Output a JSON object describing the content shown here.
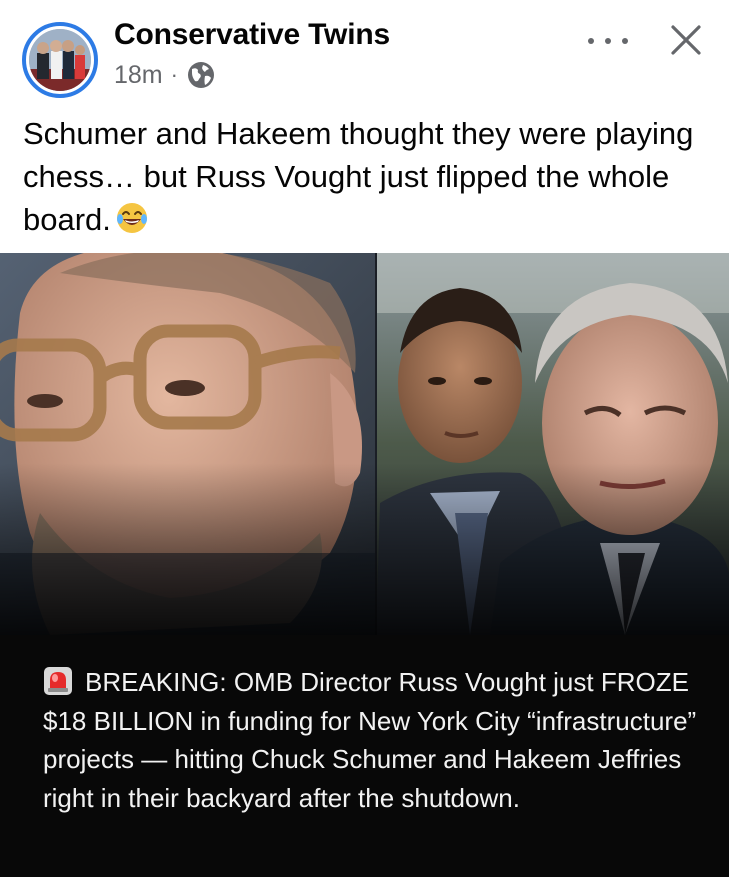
{
  "post": {
    "author": "Conservative Twins",
    "time": "18m",
    "separator": "·",
    "caption": "Schumer and Hakeem thought they were playing chess… but Russ Vought just flipped the whole board.",
    "caption_emoji": "face-with-tears-of-joy",
    "image_text": "BREAKING: OMB Director Russ Vought just FROZE $18 BILLION in funding for New York City “infrastructure” projects — hitting Chuck Schumer and Hakeem Jeffries right in their backyard after the shutdown.",
    "image_text_icon": "siren-emoji"
  },
  "icons": {
    "privacy": "globe-icon",
    "more": "more-options-icon",
    "close": "close-icon"
  },
  "colors": {
    "avatar_ring": "#2d7be5",
    "meta_text": "#65676b",
    "overlay_bg": "#080808",
    "overlay_text": "#f2f2f2"
  }
}
